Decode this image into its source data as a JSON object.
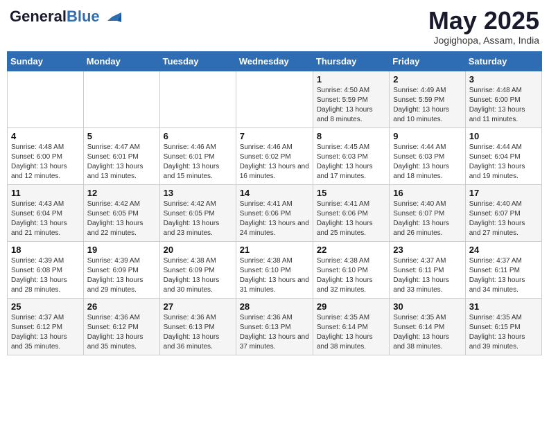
{
  "header": {
    "logo_line1": "General",
    "logo_line2": "Blue",
    "month_title": "May 2025",
    "location": "Jogighopa, Assam, India"
  },
  "weekdays": [
    "Sunday",
    "Monday",
    "Tuesday",
    "Wednesday",
    "Thursday",
    "Friday",
    "Saturday"
  ],
  "weeks": [
    [
      {
        "day": "",
        "info": ""
      },
      {
        "day": "",
        "info": ""
      },
      {
        "day": "",
        "info": ""
      },
      {
        "day": "",
        "info": ""
      },
      {
        "day": "1",
        "info": "Sunrise: 4:50 AM\nSunset: 5:59 PM\nDaylight: 13 hours and 8 minutes."
      },
      {
        "day": "2",
        "info": "Sunrise: 4:49 AM\nSunset: 5:59 PM\nDaylight: 13 hours and 10 minutes."
      },
      {
        "day": "3",
        "info": "Sunrise: 4:48 AM\nSunset: 6:00 PM\nDaylight: 13 hours and 11 minutes."
      }
    ],
    [
      {
        "day": "4",
        "info": "Sunrise: 4:48 AM\nSunset: 6:00 PM\nDaylight: 13 hours and 12 minutes."
      },
      {
        "day": "5",
        "info": "Sunrise: 4:47 AM\nSunset: 6:01 PM\nDaylight: 13 hours and 13 minutes."
      },
      {
        "day": "6",
        "info": "Sunrise: 4:46 AM\nSunset: 6:01 PM\nDaylight: 13 hours and 15 minutes."
      },
      {
        "day": "7",
        "info": "Sunrise: 4:46 AM\nSunset: 6:02 PM\nDaylight: 13 hours and 16 minutes."
      },
      {
        "day": "8",
        "info": "Sunrise: 4:45 AM\nSunset: 6:03 PM\nDaylight: 13 hours and 17 minutes."
      },
      {
        "day": "9",
        "info": "Sunrise: 4:44 AM\nSunset: 6:03 PM\nDaylight: 13 hours and 18 minutes."
      },
      {
        "day": "10",
        "info": "Sunrise: 4:44 AM\nSunset: 6:04 PM\nDaylight: 13 hours and 19 minutes."
      }
    ],
    [
      {
        "day": "11",
        "info": "Sunrise: 4:43 AM\nSunset: 6:04 PM\nDaylight: 13 hours and 21 minutes."
      },
      {
        "day": "12",
        "info": "Sunrise: 4:42 AM\nSunset: 6:05 PM\nDaylight: 13 hours and 22 minutes."
      },
      {
        "day": "13",
        "info": "Sunrise: 4:42 AM\nSunset: 6:05 PM\nDaylight: 13 hours and 23 minutes."
      },
      {
        "day": "14",
        "info": "Sunrise: 4:41 AM\nSunset: 6:06 PM\nDaylight: 13 hours and 24 minutes."
      },
      {
        "day": "15",
        "info": "Sunrise: 4:41 AM\nSunset: 6:06 PM\nDaylight: 13 hours and 25 minutes."
      },
      {
        "day": "16",
        "info": "Sunrise: 4:40 AM\nSunset: 6:07 PM\nDaylight: 13 hours and 26 minutes."
      },
      {
        "day": "17",
        "info": "Sunrise: 4:40 AM\nSunset: 6:07 PM\nDaylight: 13 hours and 27 minutes."
      }
    ],
    [
      {
        "day": "18",
        "info": "Sunrise: 4:39 AM\nSunset: 6:08 PM\nDaylight: 13 hours and 28 minutes."
      },
      {
        "day": "19",
        "info": "Sunrise: 4:39 AM\nSunset: 6:09 PM\nDaylight: 13 hours and 29 minutes."
      },
      {
        "day": "20",
        "info": "Sunrise: 4:38 AM\nSunset: 6:09 PM\nDaylight: 13 hours and 30 minutes."
      },
      {
        "day": "21",
        "info": "Sunrise: 4:38 AM\nSunset: 6:10 PM\nDaylight: 13 hours and 31 minutes."
      },
      {
        "day": "22",
        "info": "Sunrise: 4:38 AM\nSunset: 6:10 PM\nDaylight: 13 hours and 32 minutes."
      },
      {
        "day": "23",
        "info": "Sunrise: 4:37 AM\nSunset: 6:11 PM\nDaylight: 13 hours and 33 minutes."
      },
      {
        "day": "24",
        "info": "Sunrise: 4:37 AM\nSunset: 6:11 PM\nDaylight: 13 hours and 34 minutes."
      }
    ],
    [
      {
        "day": "25",
        "info": "Sunrise: 4:37 AM\nSunset: 6:12 PM\nDaylight: 13 hours and 35 minutes."
      },
      {
        "day": "26",
        "info": "Sunrise: 4:36 AM\nSunset: 6:12 PM\nDaylight: 13 hours and 35 minutes."
      },
      {
        "day": "27",
        "info": "Sunrise: 4:36 AM\nSunset: 6:13 PM\nDaylight: 13 hours and 36 minutes."
      },
      {
        "day": "28",
        "info": "Sunrise: 4:36 AM\nSunset: 6:13 PM\nDaylight: 13 hours and 37 minutes."
      },
      {
        "day": "29",
        "info": "Sunrise: 4:35 AM\nSunset: 6:14 PM\nDaylight: 13 hours and 38 minutes."
      },
      {
        "day": "30",
        "info": "Sunrise: 4:35 AM\nSunset: 6:14 PM\nDaylight: 13 hours and 38 minutes."
      },
      {
        "day": "31",
        "info": "Sunrise: 4:35 AM\nSunset: 6:15 PM\nDaylight: 13 hours and 39 minutes."
      }
    ]
  ]
}
